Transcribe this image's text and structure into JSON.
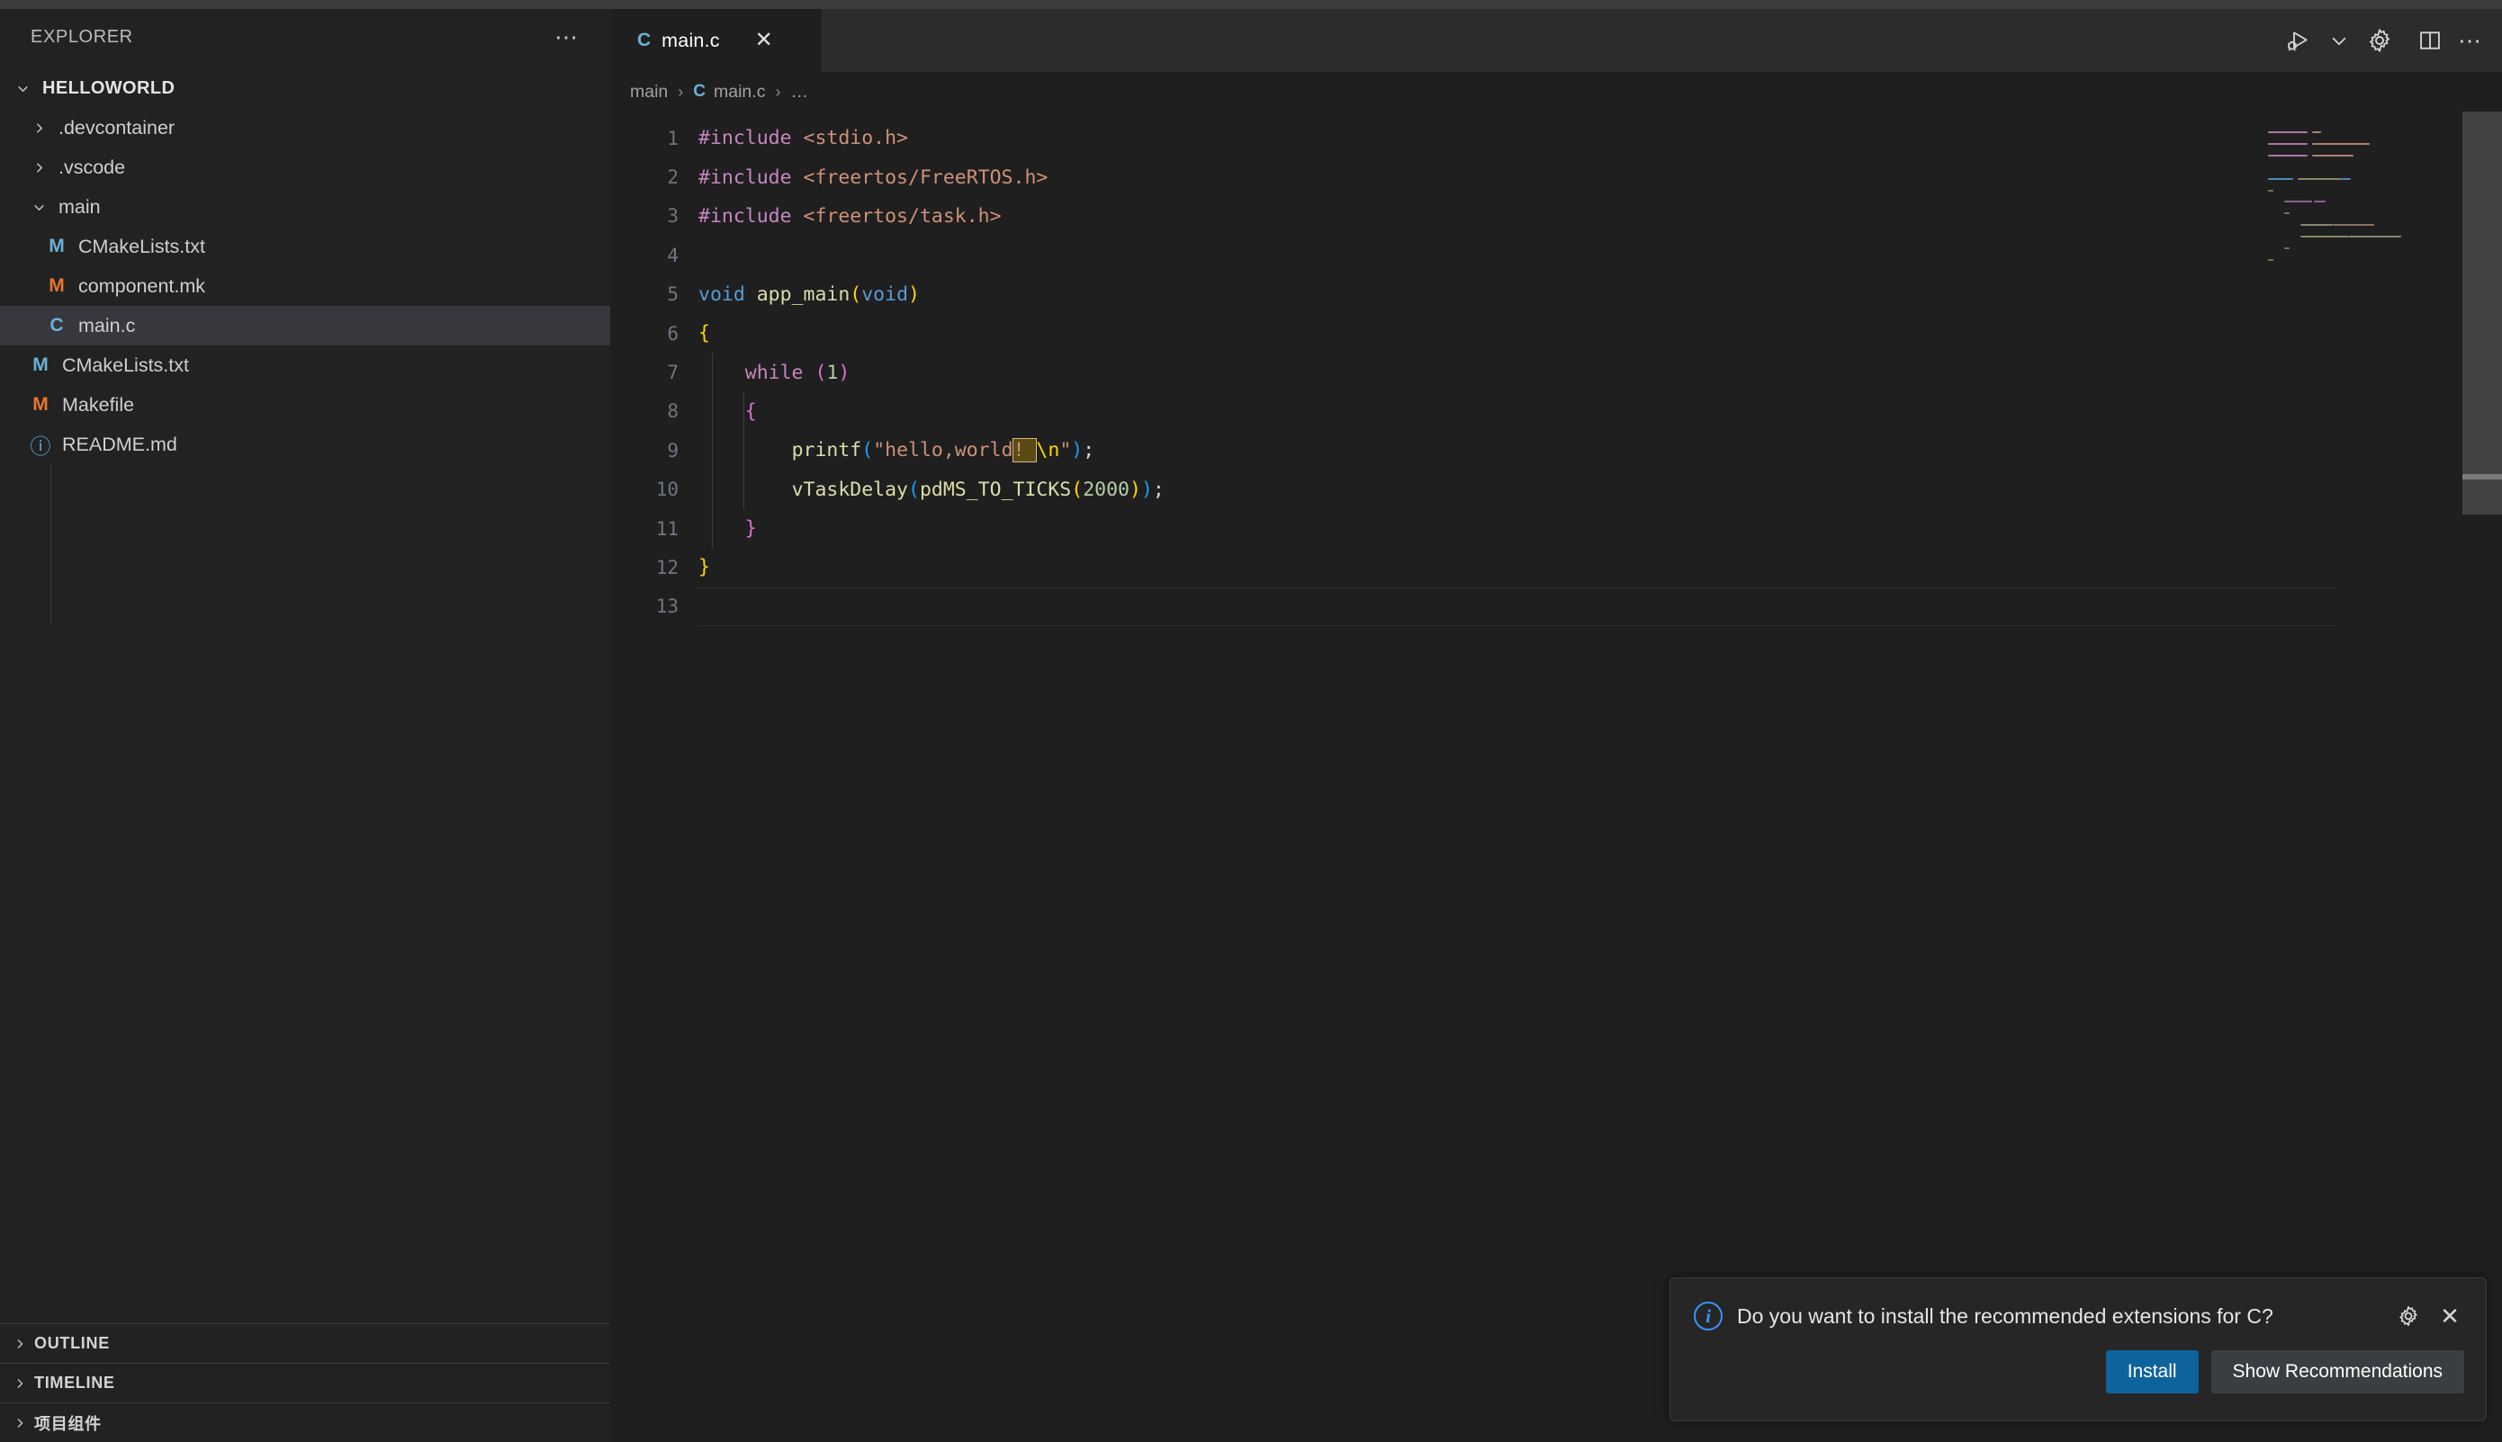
{
  "window": {
    "titlebar_color": "#3c3c3c"
  },
  "sidebar": {
    "header_title": "EXPLORER",
    "more_actions": "⋯",
    "root": {
      "label": "HELLOWORLD",
      "expanded": true
    },
    "items": [
      {
        "label": ".devcontainer",
        "type": "folder",
        "expanded": false,
        "indent": 1
      },
      {
        "label": ".vscode",
        "type": "folder",
        "expanded": false,
        "indent": 1
      },
      {
        "label": "main",
        "type": "folder",
        "expanded": true,
        "indent": 1
      },
      {
        "label": "CMakeLists.txt",
        "type": "file",
        "icon": "cmake-icon",
        "icon_letter": "M",
        "icon_color": "#6bb1d6",
        "indent": 2
      },
      {
        "label": "component.mk",
        "type": "file",
        "icon": "makefile-icon",
        "icon_letter": "M",
        "icon_color": "#e8762c",
        "indent": 2
      },
      {
        "label": "main.c",
        "type": "file",
        "icon": "c-file-icon",
        "icon_letter": "C",
        "icon_color": "#6bb1d6",
        "indent": 2,
        "selected": true
      },
      {
        "label": "CMakeLists.txt",
        "type": "file",
        "icon": "cmake-icon",
        "icon_letter": "M",
        "icon_color": "#6bb1d6",
        "indent": 1
      },
      {
        "label": "Makefile",
        "type": "file",
        "icon": "makefile-icon",
        "icon_letter": "M",
        "icon_color": "#e8762c",
        "indent": 1
      },
      {
        "label": "README.md",
        "type": "file",
        "icon": "info-md-icon",
        "icon_letter": "ⓘ",
        "icon_color": "#5dacdc",
        "indent": 1
      }
    ],
    "panels": [
      {
        "label": "OUTLINE"
      },
      {
        "label": "TIMELINE"
      },
      {
        "label": "项目组件"
      }
    ]
  },
  "editor": {
    "tab": {
      "label": "main.c",
      "icon_letter": "C",
      "icon_color": "#6bb1d6",
      "close": "✕"
    },
    "actions": [
      {
        "name": "run-and-debug-icon"
      },
      {
        "name": "chevron-down-icon"
      },
      {
        "name": "settings-gear-icon"
      },
      {
        "name": "split-editor-icon"
      },
      {
        "name": "more-actions-icon",
        "glyph": "⋯"
      }
    ],
    "breadcrumb": {
      "folder": "main",
      "file": "main.c",
      "file_icon_letter": "C",
      "more": "…",
      "separator": "›"
    },
    "line_numbers": [
      1,
      2,
      3,
      4,
      5,
      6,
      7,
      8,
      9,
      10,
      11,
      12,
      13
    ],
    "code_lines": [
      {
        "n": 1,
        "tokens": [
          {
            "t": "#include ",
            "c": "t-pre"
          },
          {
            "t": "<stdio.h>",
            "c": "t-str"
          }
        ]
      },
      {
        "n": 2,
        "tokens": [
          {
            "t": "#include ",
            "c": "t-pre"
          },
          {
            "t": "<freertos/FreeRTOS.h>",
            "c": "t-str"
          }
        ]
      },
      {
        "n": 3,
        "tokens": [
          {
            "t": "#include ",
            "c": "t-pre"
          },
          {
            "t": "<freertos/task.h>",
            "c": "t-str"
          }
        ]
      },
      {
        "n": 4,
        "tokens": []
      },
      {
        "n": 5,
        "tokens": [
          {
            "t": "void",
            "c": "t-key"
          },
          {
            "t": " app_main",
            "c": "t-fn"
          },
          {
            "t": "(",
            "c": "br-y"
          },
          {
            "t": "void",
            "c": "t-key"
          },
          {
            "t": ")",
            "c": "br-y"
          }
        ]
      },
      {
        "n": 6,
        "tokens": [
          {
            "t": "{",
            "c": "br-y"
          }
        ]
      },
      {
        "n": 7,
        "tokens": [
          {
            "t": "    ",
            "c": "t-def"
          },
          {
            "t": "while",
            "c": "t-ctl"
          },
          {
            "t": " ",
            "c": "t-def"
          },
          {
            "t": "(",
            "c": "br-p"
          },
          {
            "t": "1",
            "c": "t-num"
          },
          {
            "t": ")",
            "c": "br-p"
          }
        ]
      },
      {
        "n": 8,
        "tokens": [
          {
            "t": "    ",
            "c": "t-def"
          },
          {
            "t": "{",
            "c": "br-p"
          }
        ]
      },
      {
        "n": 9,
        "tokens": [
          {
            "t": "        ",
            "c": "t-def"
          },
          {
            "t": "printf",
            "c": "t-fn"
          },
          {
            "t": "(",
            "c": "br-b"
          },
          {
            "t": "\"hello,world",
            "c": "t-str"
          },
          {
            "t": "! ",
            "c": "t-str",
            "highlight": true
          },
          {
            "t": "\\n",
            "c": "br-y"
          },
          {
            "t": "\"",
            "c": "t-str"
          },
          {
            "t": ")",
            "c": "br-b"
          },
          {
            "t": ";",
            "c": "t-def"
          }
        ]
      },
      {
        "n": 10,
        "tokens": [
          {
            "t": "        ",
            "c": "t-def"
          },
          {
            "t": "vTaskDelay",
            "c": "t-fn"
          },
          {
            "t": "(",
            "c": "br-b"
          },
          {
            "t": "pdMS_TO_TICKS",
            "c": "t-fn"
          },
          {
            "t": "(",
            "c": "br-y"
          },
          {
            "t": "2000",
            "c": "t-num"
          },
          {
            "t": ")",
            "c": "br-y"
          },
          {
            "t": ")",
            "c": "br-b"
          },
          {
            "t": ";",
            "c": "t-def"
          }
        ]
      },
      {
        "n": 11,
        "tokens": [
          {
            "t": "    ",
            "c": "t-def"
          },
          {
            "t": "}",
            "c": "br-p"
          }
        ]
      },
      {
        "n": 12,
        "tokens": [
          {
            "t": "}",
            "c": "br-y"
          }
        ]
      },
      {
        "n": 13,
        "tokens": [],
        "current": true
      }
    ],
    "raw_text": "#include <stdio.h>\n#include <freertos/FreeRTOS.h>\n#include <freertos/task.h>\n\nvoid app_main(void)\n{\n    while (1)\n    {\n        printf(\"hello,world! \\n\");\n        vTaskDelay(pdMS_TO_TICKS(2000));\n    }\n}\n",
    "find_highlight": "! ",
    "colors": {
      "background": "#1f1f1f",
      "preprocessor": "#c586c0",
      "string": "#ce9178",
      "keyword": "#569cd6",
      "function": "#dcdcaa",
      "number": "#b5cea8",
      "control": "#c586c0",
      "bracket_yellow": "#ffd700",
      "bracket_pink": "#da70d6",
      "bracket_blue": "#179fff",
      "line_number": "#6e7681",
      "find_match_bg": "#5a4a14",
      "find_match_border": "#d7ba7d"
    }
  },
  "notification": {
    "message": "Do you want to install the recommended extensions for C?",
    "icon": "info-icon",
    "gear": "settings-gear-icon",
    "close": "✕",
    "primary_button": "Install",
    "secondary_button": "Show Recommendations",
    "primary_color": "#0e639c"
  }
}
